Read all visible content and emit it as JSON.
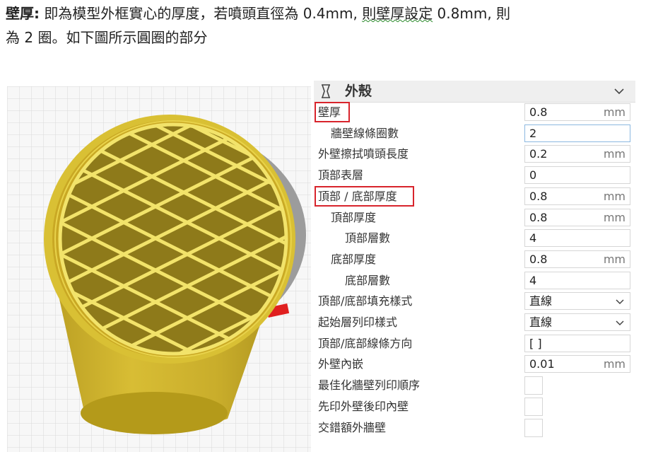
{
  "doc": {
    "line1_bold": "壁厚:",
    "line1_a": " 即為模型外框實心的厚度，若噴頭直徑為 0.4mm,",
    "line1_b": "則壁厚設定",
    "line1_c": " 0.8mm, 則",
    "line2": "為 2 圈。如下圖所示圓圈的部分"
  },
  "panel": {
    "title": "外殼",
    "header_icon": "shell-icon",
    "chevron_icon": "chevron-down-icon",
    "rows": [
      {
        "label": "壁厚",
        "value": "0.8",
        "unit": "mm",
        "kind": "field"
      },
      {
        "label": "牆壁線條圈數",
        "value": "2",
        "unit": "",
        "kind": "field"
      },
      {
        "label": "外壁擦拭噴頭長度",
        "value": "0.2",
        "unit": "mm",
        "kind": "field"
      },
      {
        "label": "頂部表層",
        "value": "0",
        "unit": "",
        "kind": "field"
      },
      {
        "label": "頂部 / 底部厚度",
        "value": "0.8",
        "unit": "mm",
        "kind": "field"
      },
      {
        "label": "頂部厚度",
        "value": "0.8",
        "unit": "mm",
        "kind": "field"
      },
      {
        "label": "頂部層數",
        "value": "4",
        "unit": "",
        "kind": "field"
      },
      {
        "label": "底部厚度",
        "value": "0.8",
        "unit": "mm",
        "kind": "field"
      },
      {
        "label": "底部層數",
        "value": "4",
        "unit": "",
        "kind": "field"
      },
      {
        "label": "頂部/底部填充樣式",
        "value": "直線",
        "unit": "",
        "kind": "select"
      },
      {
        "label": "起始層列印樣式",
        "value": "直線",
        "unit": "",
        "kind": "select"
      },
      {
        "label": "頂部/底部線條方向",
        "value": "[ ]",
        "unit": "",
        "kind": "field"
      },
      {
        "label": "外壁內嵌",
        "value": "0.01",
        "unit": "mm",
        "kind": "field"
      },
      {
        "label": "最佳化牆壁列印順序",
        "value": "",
        "unit": "",
        "kind": "checkbox"
      },
      {
        "label": "先印外壁後印內壁",
        "value": "",
        "unit": "",
        "kind": "checkbox"
      },
      {
        "label": "交錯額外牆壁",
        "value": "",
        "unit": "",
        "kind": "checkbox"
      }
    ]
  },
  "colors": {
    "model_yellow": "#e6cf3a",
    "model_dark": "#b49a1a",
    "highlight_red": "#d8242c",
    "grid_line": "#d9d9d9"
  }
}
